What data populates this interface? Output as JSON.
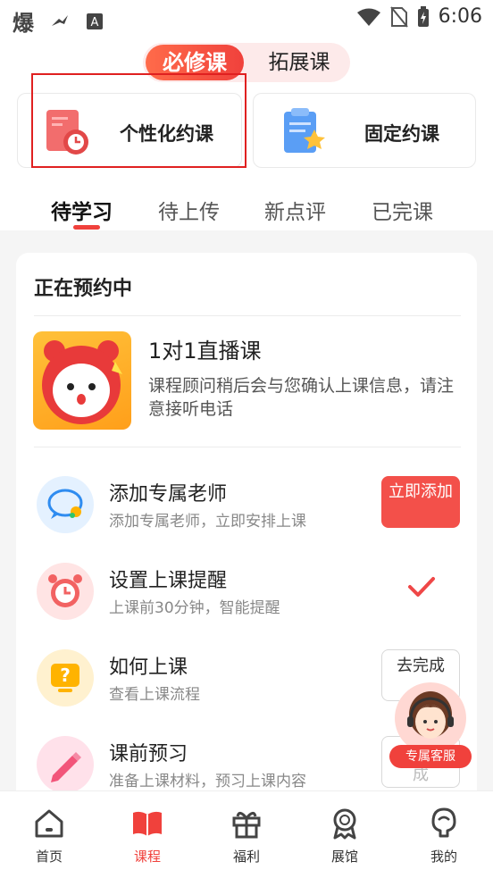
{
  "status_bar": {
    "left_glyph": "爆",
    "time": "6:06"
  },
  "course_type_toggle": {
    "active": "必修课",
    "other": "拓展课"
  },
  "booking_options": [
    {
      "label": "个性化约课"
    },
    {
      "label": "固定约课"
    }
  ],
  "tabs": [
    "待学习",
    "待上传",
    "新点评",
    "已完课"
  ],
  "section_title": "正在预约中",
  "course": {
    "title": "1对1直播课",
    "description": "课程顾问稍后会与您确认上课信息，请注意接听电话"
  },
  "tasks": [
    {
      "title": "添加专属老师",
      "subtitle": "添加专属老师，立即安排上课",
      "action": "立即添加",
      "icon": "chat-bubble-icon"
    },
    {
      "title": "设置上课提醒",
      "subtitle": "上课前30分钟，智能提醒",
      "action": "",
      "icon": "alarm-clock-icon"
    },
    {
      "title": "如何上课",
      "subtitle": "查看上课流程",
      "action": "去完成",
      "icon": "question-icon"
    },
    {
      "title": "课前预习",
      "subtitle": "准备上课材料，预习上课内容",
      "action": "成",
      "icon": "pencil-icon"
    }
  ],
  "service_label": "专属客服",
  "bottom_nav": [
    {
      "label": "首页",
      "icon": "home-icon"
    },
    {
      "label": "课程",
      "icon": "book-icon"
    },
    {
      "label": "福利",
      "icon": "gift-icon"
    },
    {
      "label": "展馆",
      "icon": "medal-icon"
    },
    {
      "label": "我的",
      "icon": "profile-icon"
    }
  ],
  "colors": {
    "accent": "#f0413c",
    "accent_light": "#fdeaea"
  }
}
